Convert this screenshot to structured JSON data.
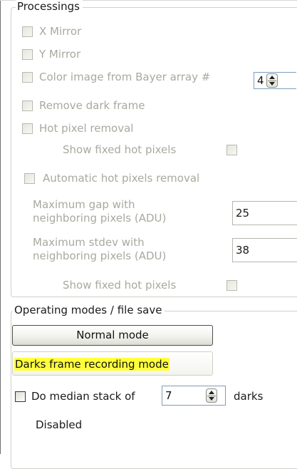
{
  "processings": {
    "legend": "Processings",
    "x_mirror_label": "X Mirror",
    "y_mirror_label": "Y Mirror",
    "bayer_label": "Color image from Bayer array #",
    "bayer_value": "4",
    "remove_dark_label": "Remove dark frame",
    "hot_pixel_label": "Hot pixel removal",
    "show_fixed_hot_pixels_label": "Show fixed hot pixels",
    "auto_hot_pixels_label": "Automatic hot pixels removal",
    "max_gap_label_line1": "Maximum gap with",
    "max_gap_label_line2": "neighboring pixels (ADU)",
    "max_gap_value": "25",
    "max_stdev_label_line1": "Maximum stdev with",
    "max_stdev_label_line2": "neighboring pixels (ADU)",
    "max_stdev_value": "38",
    "show_fixed_hot_pixels_label_2": "Show fixed hot pixels"
  },
  "operating": {
    "legend": "Operating modes / file save",
    "normal_mode_label": "Normal mode",
    "darks_mode_label": "Darks frame recording mode",
    "median_stack_label": "Do median stack of",
    "median_stack_value": "7",
    "darks_label": "darks",
    "status_text": "Disabled"
  },
  "colors": {
    "highlight": "#ffff3a",
    "disabled_text": "#a9a9a0",
    "groupbox_border": "#d0d0c8"
  }
}
